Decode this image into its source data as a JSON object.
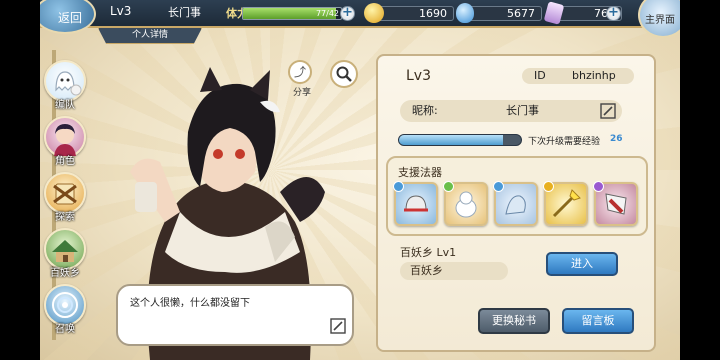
{
  "topbar": {
    "back_label": "返回",
    "level": "Lv3",
    "player_name": "长门事",
    "subtab": "个人详情",
    "stamina_label": "体力",
    "stamina_text": "77/42",
    "stamina_fraction": 0.95,
    "gold": "1690",
    "crystal": "5677",
    "gem": "766",
    "menu_label": "主界面"
  },
  "sidenav": [
    {
      "label": "编队",
      "icon": "ghost-icon"
    },
    {
      "label": "角色",
      "icon": "character-icon"
    },
    {
      "label": "探索",
      "icon": "explore-icon"
    },
    {
      "label": "百妖乡",
      "icon": "village-icon"
    },
    {
      "label": "召唤",
      "icon": "summon-icon"
    }
  ],
  "character": {
    "share_label": "分享",
    "signature": "这个人很懒，什么都没留下"
  },
  "profile": {
    "level": "Lv3",
    "id_label": "ID",
    "id_value": "bhzinhp",
    "nickname_label": "昵称:",
    "nickname_value": "长门事",
    "exp_fraction": 0.85,
    "exp_label": "下次升级需要经验",
    "exp_needed": "26",
    "support_title": "支援法器",
    "village_line": "百妖乡  Lv1",
    "village_tag": "百妖乡",
    "enter_label": "进入",
    "change_secretary_label": "更换秘书",
    "message_board_label": "留言板"
  },
  "colors": {
    "accent_blue": "#2f79c0",
    "panel_bg": "#fbf6ea",
    "topbar_bg": "#1d2a38"
  }
}
